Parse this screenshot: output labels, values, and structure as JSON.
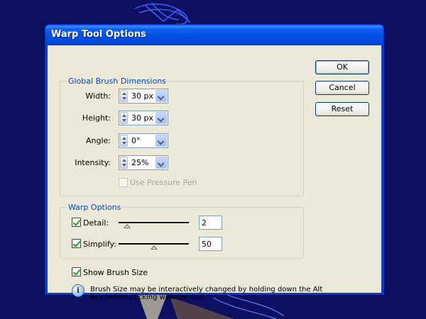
{
  "window": {
    "title": "Warp Tool Options"
  },
  "global_brush": {
    "legend": "Global Brush Dimensions",
    "width": {
      "label": "Width:",
      "value": "30 px"
    },
    "height": {
      "label": "Height:",
      "value": "30 px"
    },
    "angle": {
      "label": "Angle:",
      "value": "0°"
    },
    "intensity": {
      "label": "Intensity:",
      "value": "25%"
    },
    "use_pressure_pen": {
      "label": "Use Pressure Pen",
      "checked": false,
      "enabled": false
    }
  },
  "warp_options": {
    "legend": "Warp Options",
    "detail": {
      "label": "Detail:",
      "checked": true,
      "value": "2",
      "slider_fraction": 0.12
    },
    "simplify": {
      "label": "Simplify:",
      "checked": true,
      "value": "50",
      "slider_fraction": 0.5
    }
  },
  "show_brush_size": {
    "label": "Show Brush Size",
    "checked": true
  },
  "info": {
    "line1": "Brush Size may be interactively changed by holding down the Alt",
    "line2": "Key before clicking with the tool."
  },
  "buttons": {
    "ok": "OK",
    "cancel": "Cancel",
    "reset": "Reset"
  },
  "icons": {
    "spinner": "up-down-arrows-icon",
    "dropdown": "chevron-down-icon",
    "info": "info-icon"
  },
  "colors": {
    "desktop": "#0d1060",
    "title_bar": "#0050e6",
    "dialog_bg": "#ece9d8",
    "legend_text": "#0046d5",
    "check_mark": "#21a121"
  }
}
